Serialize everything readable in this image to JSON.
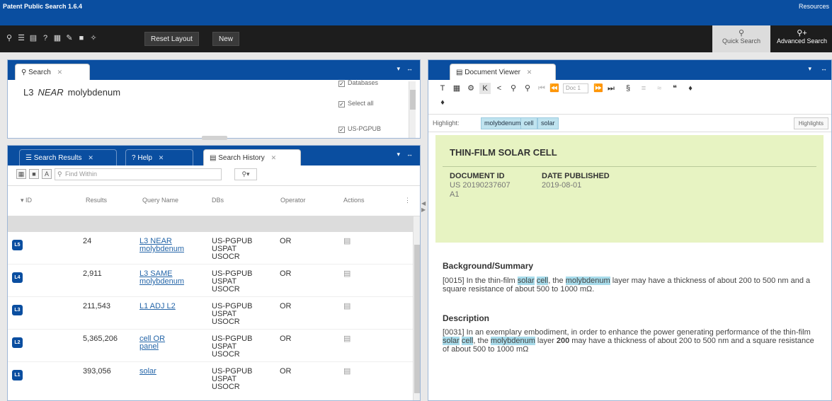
{
  "app": {
    "title": "Patent Public Search 1.6.4",
    "resources": "Resources"
  },
  "toolbar": {
    "icons": [
      "search-icon",
      "search-results-icon",
      "documents-icon",
      "help-icon",
      "print-icon",
      "notes-icon",
      "layout-icon",
      "pin-icon"
    ],
    "reset_layout": "Reset Layout",
    "new": "New",
    "quick_search": "Quick Search",
    "advanced_search": "Advanced Search"
  },
  "search_panel": {
    "tab": "Search",
    "query": {
      "term1": "L3",
      "operator": "NEAR",
      "term2": "molybdenum"
    },
    "options": {
      "partial_top": "Databases",
      "select_all": "Select all",
      "us_pgpub": "US-PGPUB"
    }
  },
  "results_panel": {
    "tabs": [
      "Search Results",
      "Help",
      "Search History"
    ],
    "filter_placeholder": "Find Within",
    "columns": [
      "ID",
      "Results",
      "Query Name",
      "DBs",
      "Operator",
      "Actions"
    ],
    "rows": [
      {
        "id": "L5",
        "results": "24",
        "query_a": "L3 NEAR",
        "query_b": "molybdenum",
        "dbs": [
          "US-PGPUB",
          "USPAT",
          "USOCR"
        ],
        "operator": "OR"
      },
      {
        "id": "L4",
        "results": "2,911",
        "query_a": "L3 SAME",
        "query_b": "molybdenum",
        "dbs": [
          "US-PGPUB",
          "USPAT",
          "USOCR"
        ],
        "operator": "OR"
      },
      {
        "id": "L3",
        "results": "211,543",
        "query_a": "L1 ADJ L2",
        "query_b": "",
        "dbs": [
          "US-PGPUB",
          "USPAT",
          "USOCR"
        ],
        "operator": "OR"
      },
      {
        "id": "L2",
        "results": "5,365,206",
        "query_a": "cell OR",
        "query_b": "panel",
        "dbs": [
          "US-PGPUB",
          "USPAT",
          "USOCR"
        ],
        "operator": "OR"
      },
      {
        "id": "L1",
        "results": "393,056",
        "query_a": "solar",
        "query_b": "",
        "dbs": [
          "US-PGPUB",
          "USPAT",
          "USOCR"
        ],
        "operator": "OR"
      }
    ]
  },
  "document_viewer": {
    "tab": "Document Viewer",
    "doc_input": "Doc 1",
    "highlight_label": "Highlight:",
    "highlight_terms": [
      "molybdenum",
      "cell",
      "solar"
    ],
    "highlights_button": "Highlights",
    "title": "THIN-FILM SOLAR CELL",
    "document_id_label": "DOCUMENT ID",
    "document_id_1": "US 20190237607",
    "document_id_2": "A1",
    "date_published_label": "DATE PUBLISHED",
    "date_published": "2019-08-01",
    "sections": [
      {
        "title": "Background/Summary",
        "p1": "[0015] In the thin-film ",
        "m1": "solar",
        "p2": " ",
        "m2": "cell",
        "p3": ", the ",
        "m3": "molybdenum",
        "p4": " layer may have a thickness of about 200 to 500 nm and a square resistance of about 500 to 1000 mΩ."
      },
      {
        "title": "Description",
        "p1": "[0031] In an exemplary embodiment, in order to enhance the power generating performance of the thin-film ",
        "m1": "solar",
        "p2": " ",
        "m2": "cell",
        "p3": ", the ",
        "m3": "molybdenum",
        "p4a": " layer ",
        "bold": "200",
        "p4": " may have a thickness of about 200 to 500 nm and a square resistance of about 500 to 1000 mΩ"
      }
    ]
  }
}
